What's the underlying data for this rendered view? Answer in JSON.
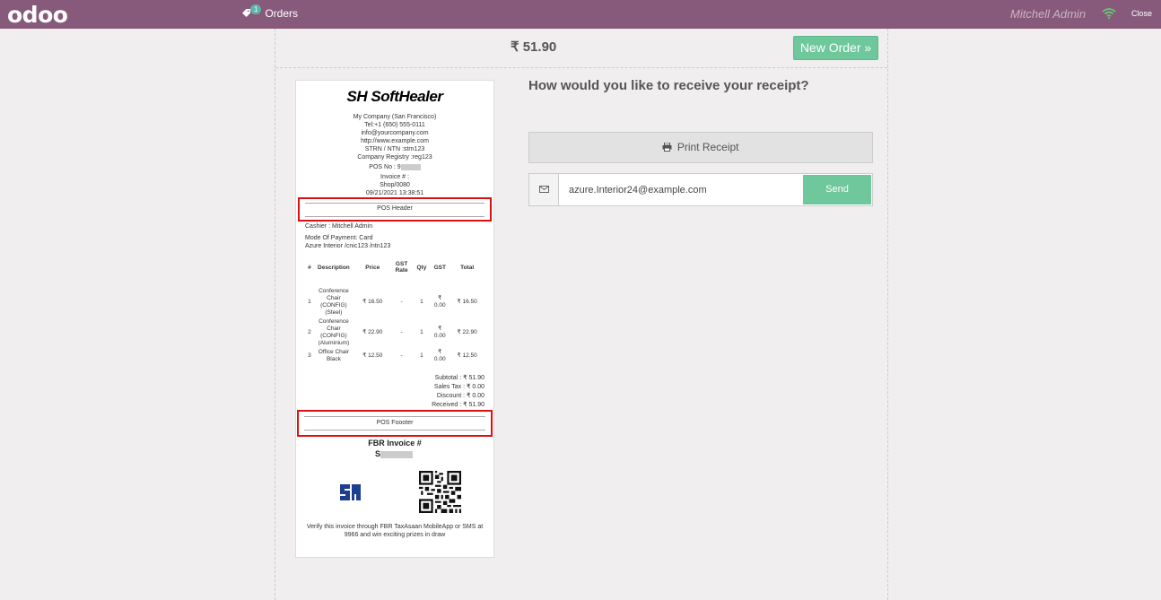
{
  "topbar": {
    "logo": "odoo",
    "orders_badge": "1",
    "orders_label": "Orders",
    "username": "Mitchell Admin",
    "close_label": "Close"
  },
  "header": {
    "total": "₹ 51.90",
    "new_order_label": "New Order »"
  },
  "receipt": {
    "brand": "SoftHealer",
    "company_lines": [
      "My Company (San Francisco)",
      "Tel:+1 (650) 555-0111",
      "info@yourcompany.com",
      "http://www.example.com",
      "STRN / NTN :strn123",
      "Company Registry :reg123"
    ],
    "pos_no_label": "POS No : 9",
    "invoice_label": "Invoice # :",
    "invoice_number": "Shop/0080",
    "datetime": "09/21/2021 13:38:51",
    "pos_header": "POS Header",
    "cashier": "Cashier : Mitchell Admin",
    "payment_mode": "Mode Of Payment: Card",
    "customer": "Azure Interior /cnic123 /ntn123",
    "columns": [
      "#",
      "Description",
      "Price",
      "GST Rate",
      "Qty",
      "GST",
      "Total"
    ],
    "items": [
      {
        "no": "1",
        "desc": "Conference Chair (CONFIG) (Steel)",
        "price": "₹ 16.50",
        "rate": "-",
        "qty": "1",
        "gst": "₹ 0.00",
        "total": "₹ 16.50"
      },
      {
        "no": "2",
        "desc": "Conference Chair (CONFIG) (Aluminium)",
        "price": "₹ 22.90",
        "rate": "-",
        "qty": "1",
        "gst": "₹ 0.00",
        "total": "₹ 22.90"
      },
      {
        "no": "3",
        "desc": "Office Chair Black",
        "price": "₹ 12.50",
        "rate": "-",
        "qty": "1",
        "gst": "₹ 0.00",
        "total": "₹ 12.50"
      }
    ],
    "subtotal": "Subtotal : ₹ 51.90",
    "sales_tax": "Sales Tax : ₹ 0.00",
    "discount": "Discount : ₹ 0.00",
    "received": "Received : ₹ 51.90",
    "pos_footer": "POS Foooter",
    "fbr_label": "FBR Invoice #",
    "fbr_prefix": "S",
    "verify_text": "Verify this invoice through FBR TaxAsaan MobileApp or SMS at 9966 and win exciting prizes in draw"
  },
  "panel": {
    "question": "How would you like to receive your receipt?",
    "print_label": "Print Receipt",
    "email_value": "azure.Interior24@example.com",
    "send_label": "Send"
  },
  "icons": {
    "orders": "tag-icon",
    "wifi": "wifi-icon",
    "printer": "printer-icon",
    "email": "envelope-icon"
  },
  "colors": {
    "topbar": "#875a7b",
    "accent_green": "#6ec89b",
    "highlight_red": "#dd1111"
  }
}
